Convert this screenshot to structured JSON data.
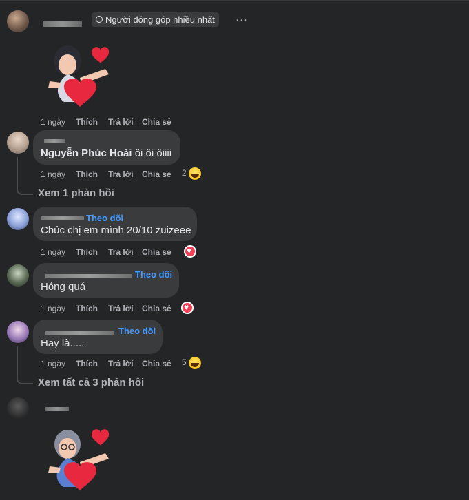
{
  "comments": [
    {
      "badge": "Người đóng góp nhiều nhất",
      "more": "···",
      "actions": {
        "time": "1 ngày",
        "like": "Thích",
        "reply": "Trả lời",
        "share": "Chia sẻ"
      }
    },
    {
      "name": "Nguyễn Phúc Hoài",
      "text": "ôi ôi ôiiii",
      "actions": {
        "time": "1 ngày",
        "like": "Thích",
        "reply": "Trả lời",
        "share": "Chia sẻ"
      },
      "reaction_count": "2",
      "reaction": "haha-icon",
      "replies": "Xem 1 phản hồi"
    },
    {
      "follow": "Theo dõi",
      "text": "Chúc chị em mình 20/10 zuizeee",
      "actions": {
        "time": "1 ngày",
        "like": "Thích",
        "reply": "Trả lời",
        "share": "Chia sẻ"
      },
      "reaction": "love-icon"
    },
    {
      "follow": "Theo dõi",
      "text": "Hóng quá",
      "actions": {
        "time": "1 ngày",
        "like": "Thích",
        "reply": "Trả lời",
        "share": "Chia sẻ"
      },
      "reaction": "love-icon"
    },
    {
      "follow": "Theo dõi",
      "text": "Hay là.....",
      "actions": {
        "time": "1 ngày",
        "like": "Thích",
        "reply": "Trả lời",
        "share": "Chia sẻ"
      },
      "reaction_count": "5",
      "reaction": "haha-icon",
      "replies": "Xem tất cả 3 phản hồi"
    },
    {}
  ],
  "colors": {
    "background": "#242526",
    "bubble": "#3a3b3c",
    "link": "#4599ff",
    "love": "#f33e58"
  }
}
